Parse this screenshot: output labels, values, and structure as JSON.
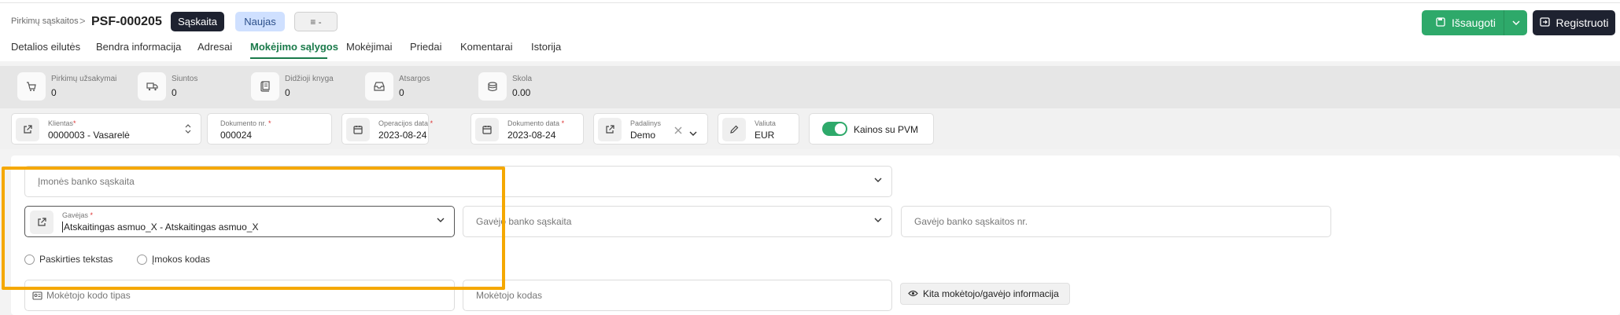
{
  "header": {
    "breadcrumb": "Pirkimų sąskaitos",
    "breadcrumb_separator": ">",
    "document_id": "PSF-000205",
    "type_badge": "Sąskaita",
    "status_badge": "Naujas",
    "menu_label": "≡ -",
    "save_button": "Išsaugoti",
    "register_button": "Registruoti"
  },
  "tabs": [
    "Detalios eilutės",
    "Bendra informacija",
    "Adresai",
    "Mokėjimo sąlygos",
    "Mokėjimai",
    "Priedai",
    "Komentarai",
    "Istorija"
  ],
  "active_tab": "Mokėjimo sąlygos",
  "stats": [
    {
      "label": "Pirkimų užsakymai",
      "value": "0",
      "icon": "cart-icon"
    },
    {
      "label": "Siuntos",
      "value": "0",
      "icon": "truck-icon"
    },
    {
      "label": "Didžioji knyga",
      "value": "0",
      "icon": "ledger-icon"
    },
    {
      "label": "Atsargos",
      "value": "0",
      "icon": "inbox-icon"
    },
    {
      "label": "Skola",
      "value": "0.00",
      "icon": "coins-icon"
    }
  ],
  "fields": {
    "client": {
      "label": "Klientas",
      "required": "*",
      "value": "0000003 - Vasarelė"
    },
    "document_no": {
      "label": "Dokumento nr.",
      "required": "*",
      "value": "000024"
    },
    "operation_date": {
      "label": "Operacijos data",
      "required": "*",
      "value": "2023-08-24"
    },
    "document_date": {
      "label": "Dokumento data",
      "required": "*",
      "value": "2023-08-24"
    },
    "department": {
      "label": "Padalinys",
      "value": "Demo"
    },
    "currency": {
      "label": "Valiuta",
      "value": "EUR"
    },
    "prices_vat": {
      "label": "Kainos su PVM",
      "enabled": true
    }
  },
  "payment": {
    "company_bank_account": "Įmonės banko sąskaita",
    "payee": {
      "label": "Gavėjas",
      "required": "*",
      "value": "Atskaitingas asmuo_X - Atskaitingas asmuo_X"
    },
    "payee_bank_account": "Gavėjo banko sąskaita",
    "payee_bank_account_no": "Gavėjo banko sąskaitos nr.",
    "radio_purpose": "Paskirties tekstas",
    "radio_code": "Įmokos kodas",
    "payer_code_type": "Mokėtojo kodo tipas",
    "payer_code": "Mokėtojo kodas",
    "other_info_button": "Kita mokėtojo/gavėjo informacija"
  },
  "colors": {
    "accent": "#1a7a4a",
    "save_green": "#2ea96a",
    "dark": "#1e2230",
    "highlight": "#f5a800",
    "badge_blue": "#cfe0ff"
  }
}
